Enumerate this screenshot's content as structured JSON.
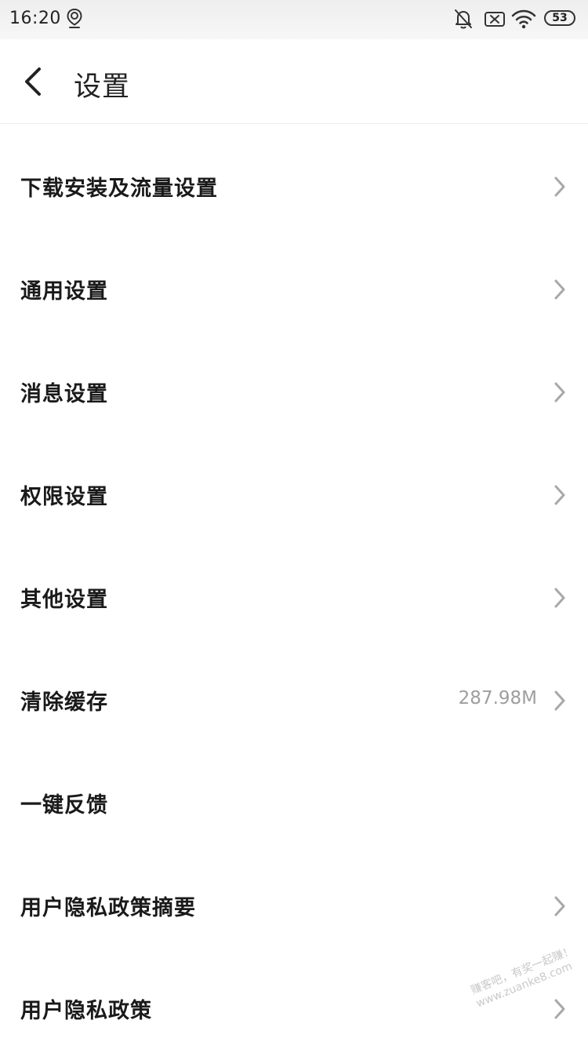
{
  "status_bar": {
    "time": "16:20",
    "battery_level": "53",
    "icons": [
      "map-pin-icon",
      "bell-off-icon",
      "sim-x-icon",
      "wifi-icon",
      "battery-icon"
    ]
  },
  "header": {
    "title": "设置",
    "back_icon": "chevron-left-icon"
  },
  "settings_items": [
    {
      "label": "下载安装及流量设置",
      "value": "",
      "has_chevron": true
    },
    {
      "label": "通用设置",
      "value": "",
      "has_chevron": true
    },
    {
      "label": "消息设置",
      "value": "",
      "has_chevron": true
    },
    {
      "label": "权限设置",
      "value": "",
      "has_chevron": true
    },
    {
      "label": "其他设置",
      "value": "",
      "has_chevron": true
    },
    {
      "label": "清除缓存",
      "value": "287.98M",
      "has_chevron": true
    },
    {
      "label": "一键反馈",
      "value": "",
      "has_chevron": false
    },
    {
      "label": "用户隐私政策摘要",
      "value": "",
      "has_chevron": true
    },
    {
      "label": "用户隐私政策",
      "value": "",
      "has_chevron": true
    }
  ],
  "watermark": {
    "line1": "赚客吧，有奖一起赚！",
    "line2": "www.zuanke8.com"
  },
  "colors": {
    "text_primary": "#1a1a1a",
    "text_secondary": "#9e9e9e",
    "chevron": "#a8a8a8",
    "divider": "#ececec"
  }
}
